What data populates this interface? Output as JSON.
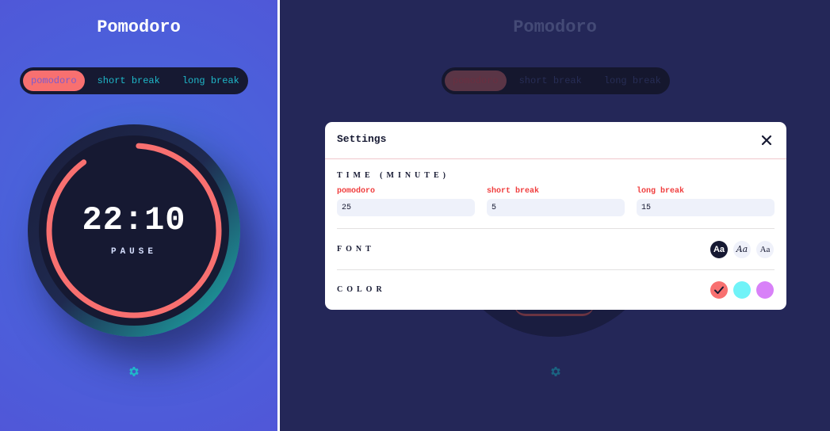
{
  "app": {
    "title": "Pomodoro",
    "modes": [
      "pomodoro",
      "short break",
      "long break"
    ],
    "active_mode": "pomodoro"
  },
  "timer": {
    "time": "22:10",
    "action": "PAUSE",
    "progress_remaining": 0.89
  },
  "settings": {
    "title": "Settings",
    "close_icon": "close-icon",
    "time_section": "TIME (MINUTE)",
    "fields": [
      {
        "label": "pomodoro",
        "value": "25"
      },
      {
        "label": "short break",
        "value": "5"
      },
      {
        "label": "long break",
        "value": "15"
      }
    ],
    "font_section": "FONT",
    "font_options": [
      "Aa",
      "Aa",
      "Aa"
    ],
    "font_selected_index": 0,
    "color_section": "COLOR",
    "color_options": [
      "#f87070",
      "#70f3f8",
      "#d881f8"
    ],
    "color_selected_index": 0
  },
  "colors": {
    "accent": "#f87070",
    "background_left": "#4a63db",
    "background_dim": "#242758",
    "panel_dark": "#161932",
    "label_red": "#f03d3d",
    "tab_text": "#1fb8c9"
  },
  "icons": {
    "settings": "gear-icon",
    "check": "check-icon"
  }
}
